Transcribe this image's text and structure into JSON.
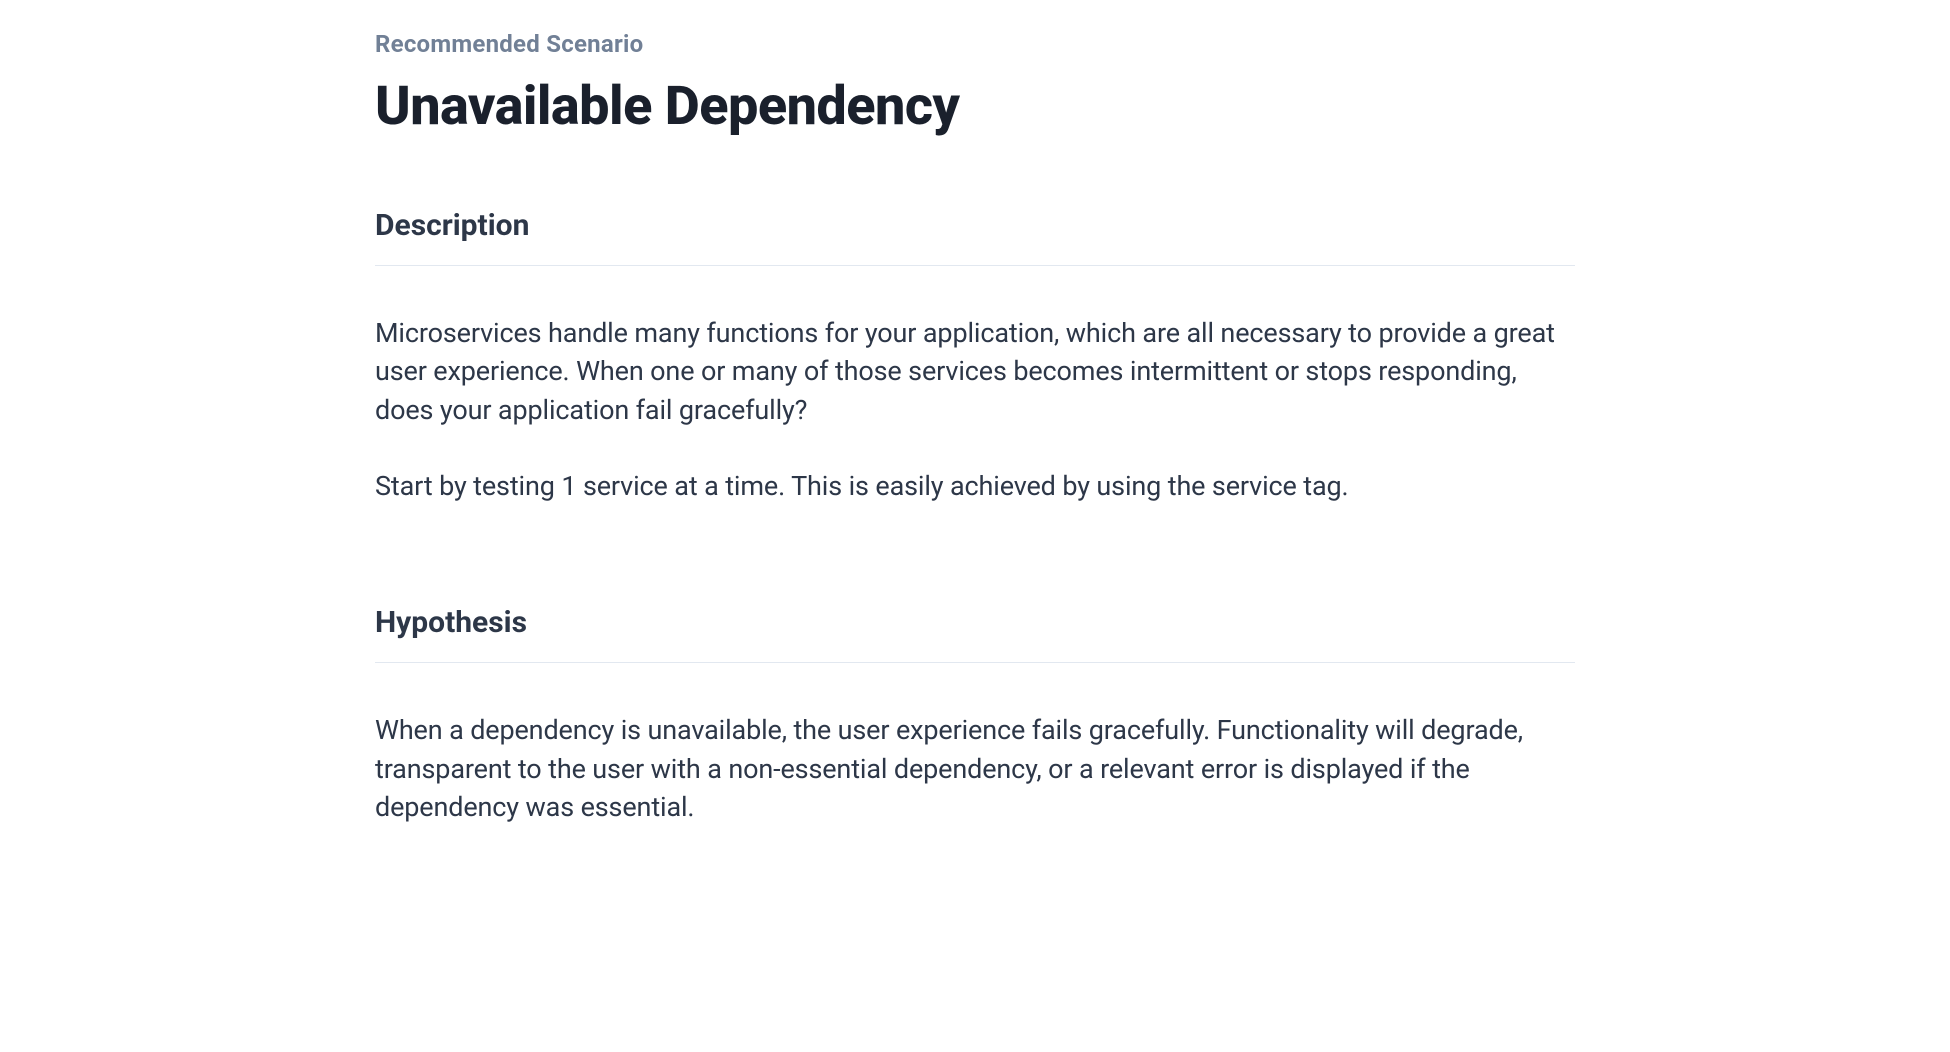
{
  "eyebrow": "Recommended Scenario",
  "title": "Unavailable Dependency",
  "sections": {
    "description": {
      "heading": "Description",
      "paragraph1": "Microservices handle many functions for your application, which are all necessary to provide a great user experience. When one or many of those services becomes intermittent or stops responding, does your application fail gracefully?",
      "paragraph2": "Start by testing 1 service at a time. This is easily achieved by using the service tag."
    },
    "hypothesis": {
      "heading": "Hypothesis",
      "paragraph1": "When a dependency is unavailable, the user experience fails gracefully. Functionality will degrade, transparent to the user with a non-essential dependency, or a relevant error is displayed if the dependency was essential."
    }
  }
}
